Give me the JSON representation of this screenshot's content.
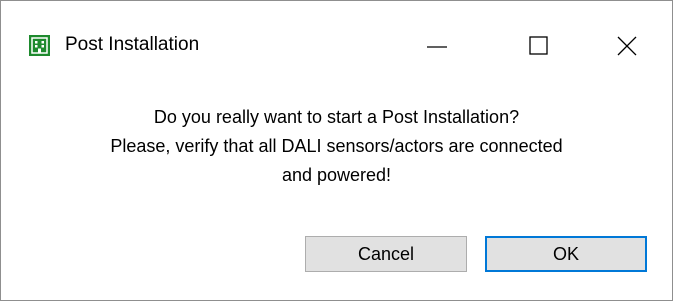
{
  "window": {
    "title": "Post Installation",
    "icon": "building-icon",
    "controls": {
      "minimize": "minimize-icon",
      "maximize": "maximize-icon",
      "close": "close-icon"
    }
  },
  "dialog": {
    "message_lines": [
      "Do you really want to start a Post Installation?",
      "Please, verify that all DALI sensors/actors are connected",
      "and powered!"
    ],
    "buttons": {
      "cancel_label": "Cancel",
      "ok_label": "OK"
    }
  },
  "colors": {
    "icon_green": "#1e8a2e",
    "focus_blue": "#0078d7",
    "button_bg": "#e1e1e1"
  }
}
